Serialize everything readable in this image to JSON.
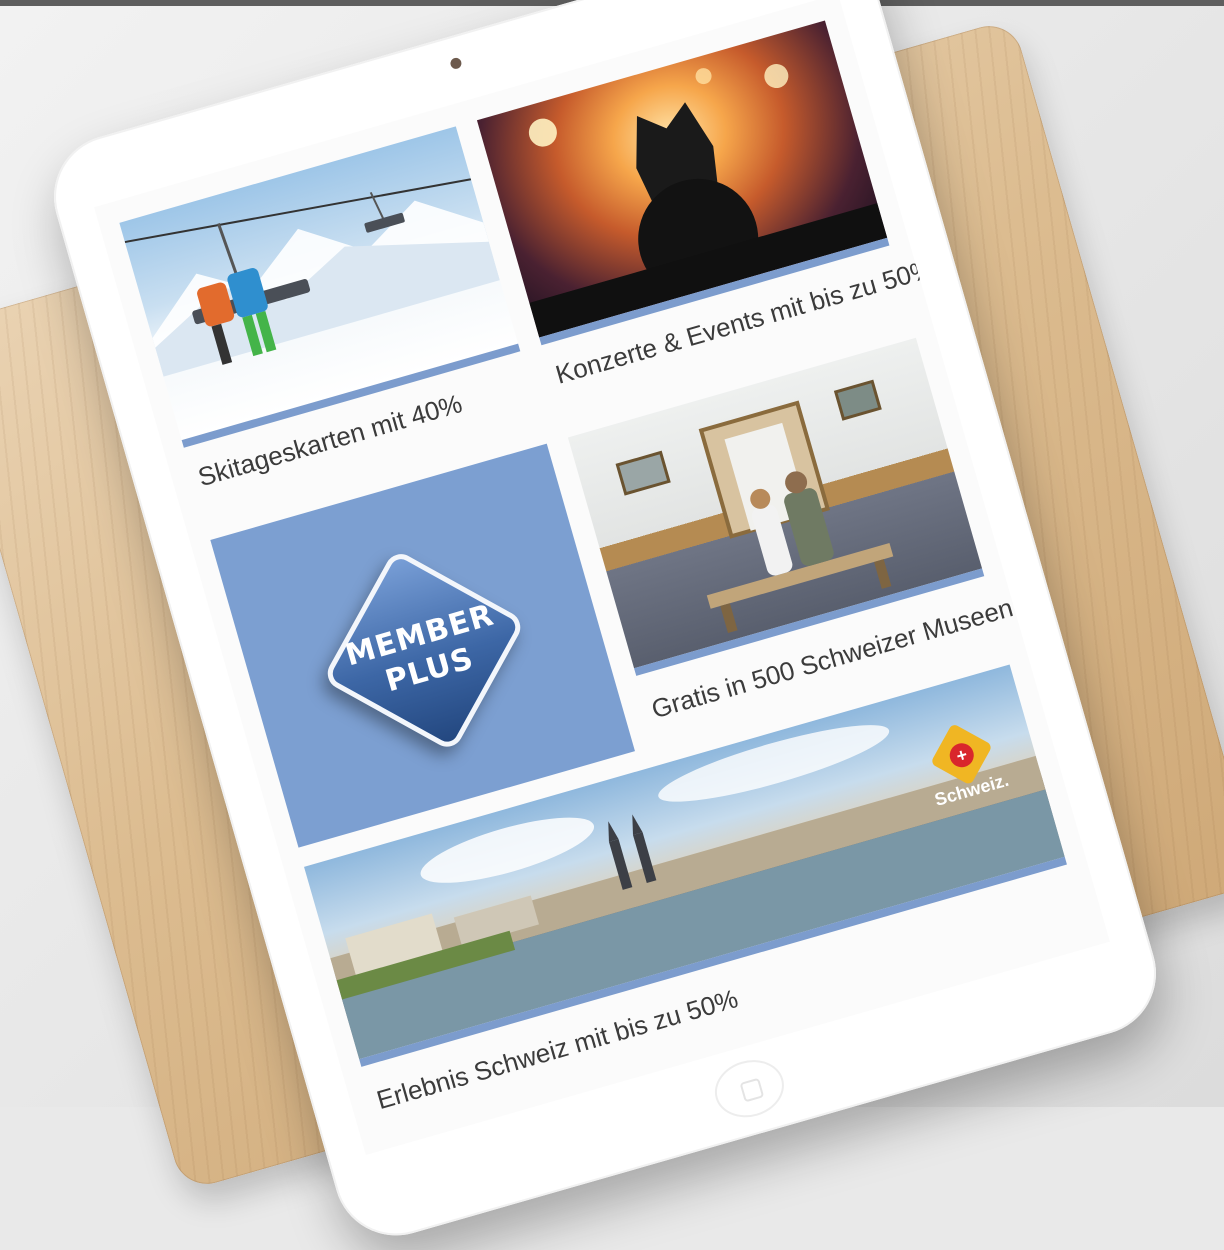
{
  "screen": {
    "tiles": {
      "ski": {
        "caption": "Skitageskarten mit 40%"
      },
      "concert": {
        "caption": "Konzerte & Events mit bis zu 50%"
      },
      "member": {
        "logo_line1": "MEMBER",
        "logo_line2": "PLUS"
      },
      "museum": {
        "caption": "Gratis in 500 Schweizer Museen"
      },
      "schweiz": {
        "caption": "Erlebnis Schweiz mit bis zu 50%",
        "brand": "Schweiz."
      }
    }
  },
  "colors": {
    "accent_blue": "#7c9ccd",
    "member_tile": "#7c9fd1",
    "swiss_red": "#d9262c",
    "swiss_gold": "#f0b623"
  }
}
